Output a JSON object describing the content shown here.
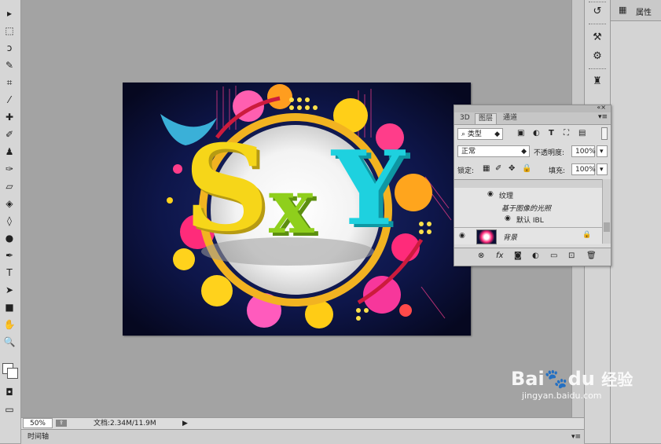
{
  "toolbar": {
    "tools": [
      {
        "name": "move-tool-icon",
        "glyph": "▸"
      },
      {
        "name": "marquee-tool-icon",
        "glyph": "⬚"
      },
      {
        "name": "lasso-tool-icon",
        "glyph": "ↄ"
      },
      {
        "name": "quick-select-tool-icon",
        "glyph": "✎"
      },
      {
        "name": "crop-tool-icon",
        "glyph": "⌗"
      },
      {
        "name": "eyedropper-tool-icon",
        "glyph": "⁄"
      },
      {
        "name": "healing-brush-tool-icon",
        "glyph": "✚"
      },
      {
        "name": "brush-tool-icon",
        "glyph": "✐"
      },
      {
        "name": "stamp-tool-icon",
        "glyph": "♟"
      },
      {
        "name": "history-brush-tool-icon",
        "glyph": "✑"
      },
      {
        "name": "eraser-tool-icon",
        "glyph": "▱"
      },
      {
        "name": "paint-bucket-tool-icon",
        "glyph": "◈"
      },
      {
        "name": "blur-tool-icon",
        "glyph": "◊"
      },
      {
        "name": "dodge-tool-icon",
        "glyph": "●"
      },
      {
        "name": "pen-tool-icon",
        "glyph": "✒"
      },
      {
        "name": "type-tool-icon",
        "glyph": "T"
      },
      {
        "name": "path-select-tool-icon",
        "glyph": "➤"
      },
      {
        "name": "shape-tool-icon",
        "glyph": "■"
      },
      {
        "name": "hand-tool-icon",
        "glyph": "✋"
      },
      {
        "name": "zoom-tool-icon",
        "glyph": "🔍"
      }
    ]
  },
  "properties_panel": {
    "label": "属性"
  },
  "layers_panel": {
    "tabs": [
      "3D",
      "图层",
      "通道"
    ],
    "filter_kind": "类型",
    "blend_mode": "正常",
    "opacity_label": "不透明度:",
    "opacity_value": "100%",
    "lock_label": "锁定:",
    "fill_label": "填充:",
    "fill_value": "100%",
    "rows": {
      "effect_texture": "纹理",
      "image_based_light": "基于图像的光照",
      "default_ibl": "默认 IBL",
      "background_layer": "背景"
    },
    "footer_icons": [
      "link-icon",
      "fx-icon",
      "mask-icon",
      "adjustment-icon",
      "folder-icon",
      "new-layer-icon",
      "trash-icon"
    ]
  },
  "artwork": {
    "text": "SxY"
  },
  "status_bar": {
    "zoom": "50%",
    "doc_info": "文档:2.34M/11.9M"
  },
  "timeline": {
    "label": "时间轴"
  },
  "watermark": {
    "brand_prefix": "Bai",
    "brand_suffix": "du",
    "product": "经验",
    "url": "jingyan.baidu.com"
  },
  "colors": {
    "canvas_dark": "#0b1036",
    "yellow": "#f6d619",
    "green": "#8fcf1c",
    "cyan": "#1ed1df",
    "panel": "#dcdcdc"
  }
}
